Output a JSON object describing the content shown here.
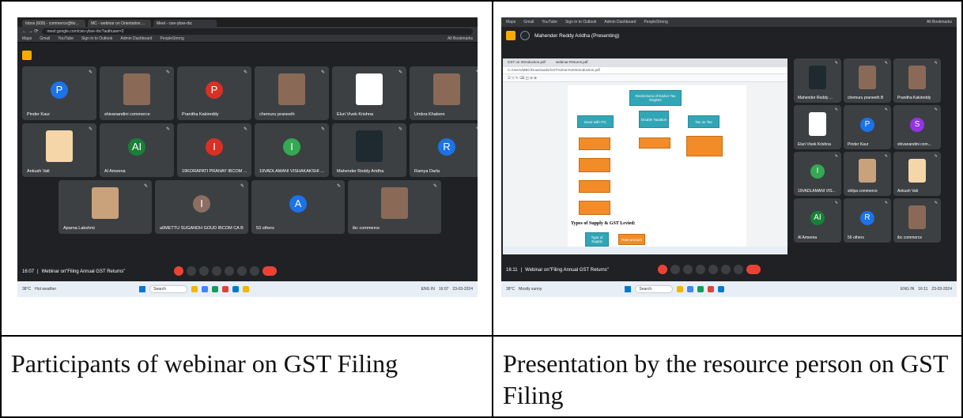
{
  "left": {
    "tabs": [
      "Inbox (609) - commerce@tkr...",
      "MC - webinar on Orientation ...",
      "Meet - cwv-ybxe-rbc"
    ],
    "url": "meet.google.com/cwv-ybxe-rbc?authuser=2",
    "bookmarks": [
      "Maps",
      "Gmail",
      "YouTube",
      "Sign in to Outlook",
      "Admin Dashboard",
      "PeopleStrong",
      "All Bookmarks"
    ],
    "tiles": [
      {
        "name": "Pinder Kaur",
        "initial": "P",
        "color": "#1a73e8"
      },
      {
        "name": "shivanandini commerce",
        "initial": "",
        "color": "#8a6a56"
      },
      {
        "name": "Pranitha Kakireddy",
        "initial": "P",
        "color": "#d93025"
      },
      {
        "name": "chemuru praneeth",
        "initial": "",
        "color": "#8a6a56"
      },
      {
        "name": "Eluri Vivek Krishna",
        "initial": "",
        "color": "#ffffff"
      },
      {
        "name": "Umbra Khatoon",
        "initial": "",
        "color": "#8a6a56"
      },
      {
        "name": "Ankush Vali",
        "initial": "",
        "color": "#f5d6a8"
      },
      {
        "name": "Al Ameena",
        "initial": "AI",
        "color": "#188038"
      },
      {
        "name": "19KORAPATI PRANAY IBCOM ...",
        "initial": "I",
        "color": "#d93025"
      },
      {
        "name": "19VADLAMANI VISHAKAKSHI ...",
        "initial": "I",
        "color": "#34a853"
      },
      {
        "name": "Mahender Reddy Aridha",
        "initial": "",
        "color": "#1f2a30"
      },
      {
        "name": "Ramya Darla",
        "initial": "R",
        "color": "#1a73e8"
      },
      {
        "name": "Aparna Lakshmi",
        "initial": "",
        "color": "#c9a27c"
      },
      {
        "name": "a0METTU SUGANDH GOUD IBCOM CA B",
        "initial": "I",
        "color": "#8d6e63"
      },
      {
        "name": "53 others",
        "initial": "A",
        "color": "#1a73e8"
      },
      {
        "name": "ibc commerce",
        "initial": "",
        "color": "#8a6a56"
      }
    ],
    "time": "16:07",
    "meeting_title": "Webinar on\"Filing Annual GST Returns\"",
    "weather_temp": "38°C",
    "weather_desc": "Hot weather",
    "search": "Search",
    "lang": "ENG IN",
    "clock_time": "16:07",
    "clock_date": "23-03-2024"
  },
  "right": {
    "bookmarks": [
      "Maps",
      "Gmail",
      "YouTube",
      "Sign in to Outlook",
      "Admin Dashboard",
      "PeopleStrong",
      "All Bookmarks"
    ],
    "presenter": "Mahender Reddy Aridha (Presenting)",
    "pdf_tabs": [
      "GST on Introduction.pdf",
      "webinar-Returns.pdf"
    ],
    "pdf_path": "C:/Users/MBC/Downloads/GST%20on%20Introduction.pdf",
    "chart": {
      "root": "Restrictions of Earlier Tax Regime",
      "branches": [
        "Issue with ITC",
        "Double Taxation",
        "Tax on Tax"
      ],
      "caption": "Types of Supply & GST Levied:",
      "supply": [
        "Type of Supply",
        "Rate amount"
      ]
    },
    "side_tiles": [
      {
        "name": "Mahender Reddy ...",
        "initial": "",
        "color": "#1f2a30"
      },
      {
        "name": "chemuru praneeth B",
        "initial": "",
        "color": "#8a6a56"
      },
      {
        "name": "Pranitha Kakireddy",
        "initial": "",
        "color": "#8a6a56"
      },
      {
        "name": "Eluri Vivek Krishna",
        "initial": "",
        "color": "#ffffff"
      },
      {
        "name": "Pinder Kaur",
        "initial": "P",
        "color": "#1a73e8"
      },
      {
        "name": "shivanandini com...",
        "initial": "S",
        "color": "#9334e6"
      },
      {
        "name": "19VADLAMANI VIS...",
        "initial": "I",
        "color": "#34a853"
      },
      {
        "name": "shilpa commerce",
        "initial": "",
        "color": "#c9a27c"
      },
      {
        "name": "Ankush Vali",
        "initial": "",
        "color": "#f5d6a8"
      },
      {
        "name": "Al Ameena",
        "initial": "AI",
        "color": "#188038"
      },
      {
        "name": "56 others",
        "initial": "R",
        "color": "#1a73e8"
      },
      {
        "name": "ibc commerce",
        "initial": "",
        "color": "#8a6a56"
      }
    ],
    "time": "16:11",
    "meeting_title": "Webinar on\"Filing Annual GST Returns\"",
    "weather_temp": "38°C",
    "weather_desc": "Mostly sunny",
    "search": "Search",
    "lang": "ENG IN",
    "clock_time": "16:11",
    "clock_date": "23-03-2024"
  },
  "captions": {
    "left": "Participants of webinar on GST Filing",
    "right": "Presentation by the resource person on GST Filing"
  }
}
